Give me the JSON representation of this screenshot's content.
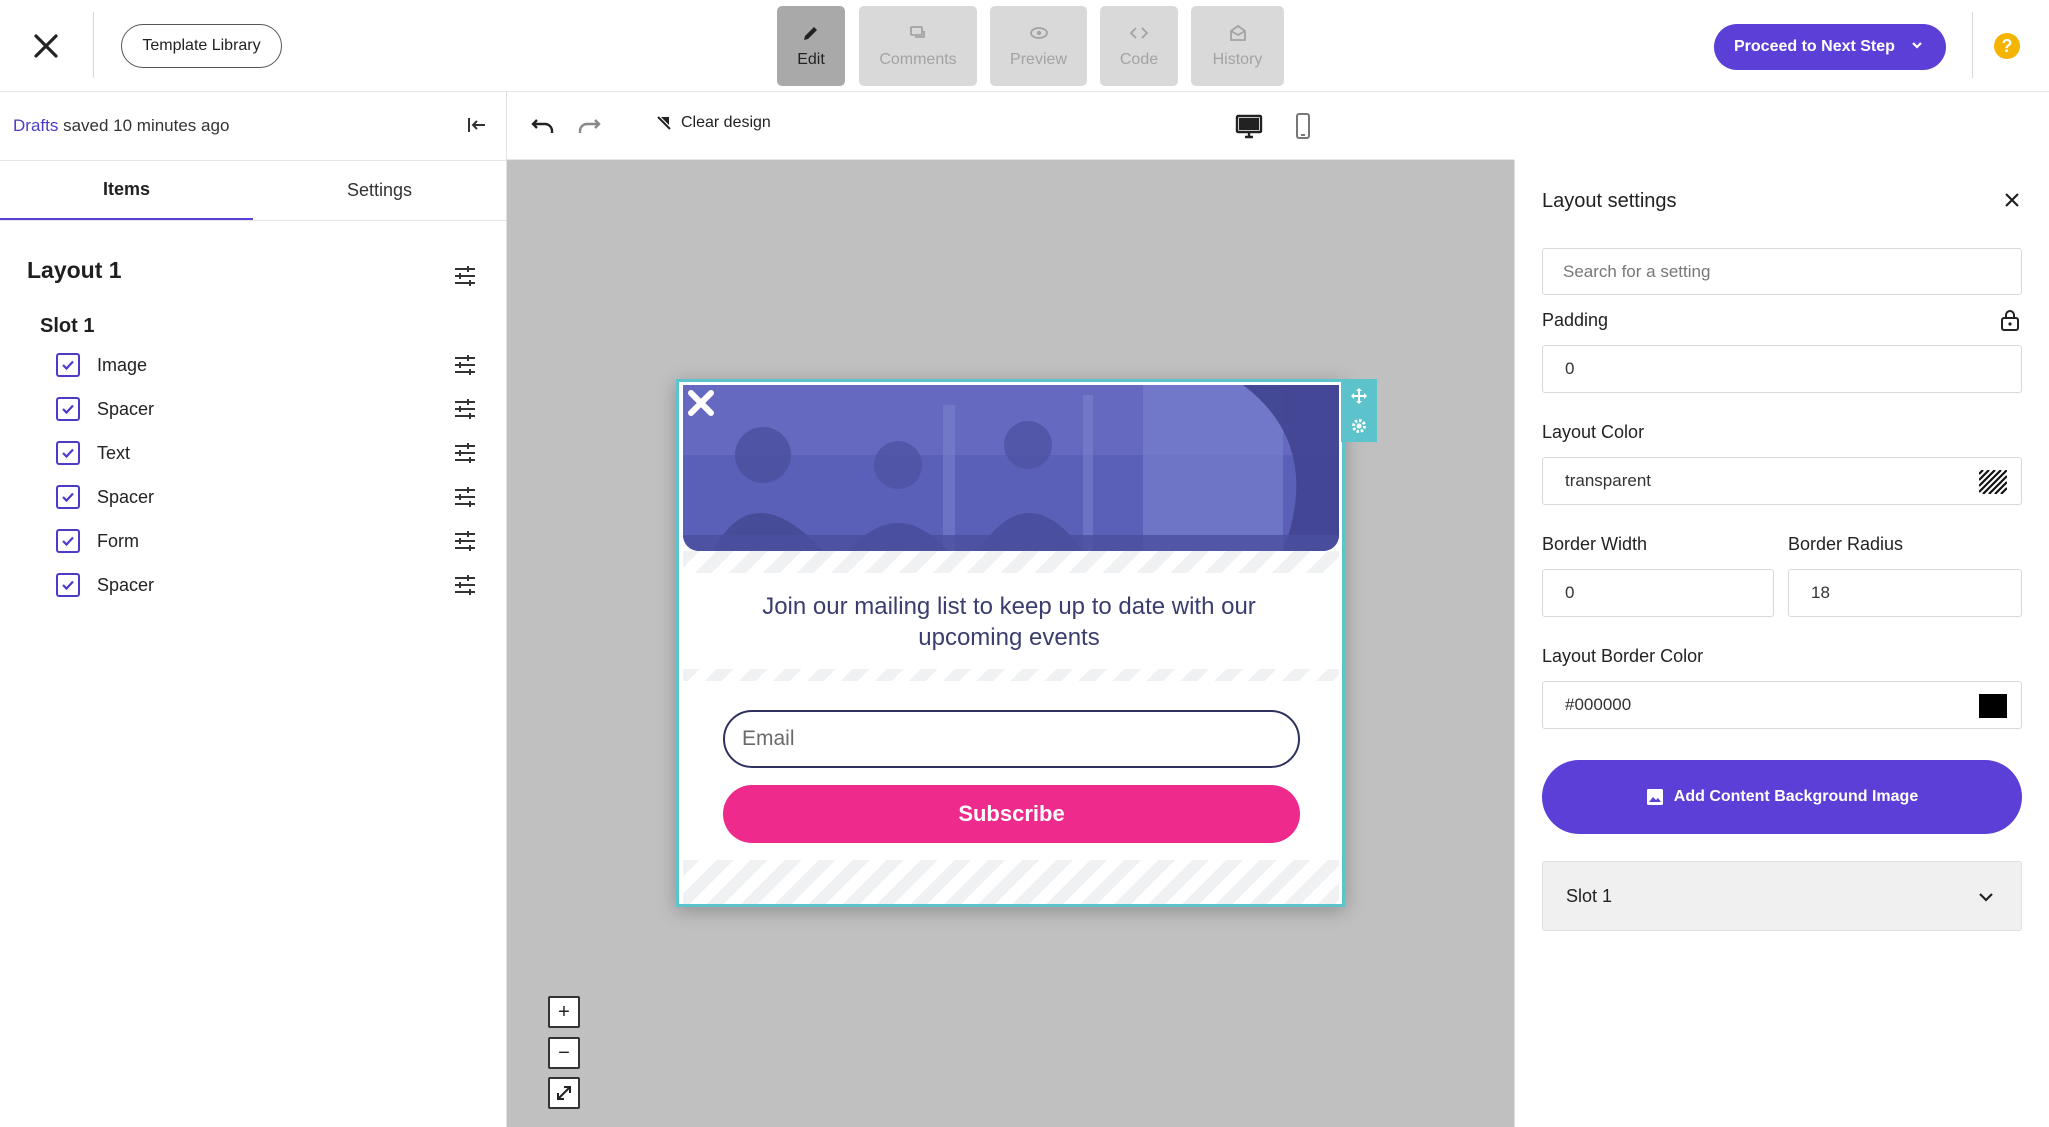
{
  "header": {
    "template_library": "Template Library",
    "modes": [
      {
        "label": "Edit",
        "icon": "pencil-icon"
      },
      {
        "label": "Comments",
        "icon": "comments-icon"
      },
      {
        "label": "Preview",
        "icon": "eye-icon"
      },
      {
        "label": "Code",
        "icon": "code-icon"
      },
      {
        "label": "History",
        "icon": "history-icon"
      }
    ],
    "proceed": "Proceed to Next Step",
    "help": "?"
  },
  "left_panel": {
    "saved_link": "Drafts",
    "saved_text": " saved 10 minutes ago",
    "tabs": [
      "Items",
      "Settings"
    ],
    "layout_title": "Layout 1",
    "slot_title": "Slot 1",
    "items": [
      {
        "label": "Image",
        "checked": true
      },
      {
        "label": "Spacer",
        "checked": true
      },
      {
        "label": "Text",
        "checked": true
      },
      {
        "label": "Spacer",
        "checked": true
      },
      {
        "label": "Form",
        "checked": true
      },
      {
        "label": "Spacer",
        "checked": true
      }
    ]
  },
  "toolbar": {
    "clear_design": "Clear design"
  },
  "popup": {
    "headline": "Join our mailing list to keep up to date with our upcoming events",
    "email_placeholder": "Email",
    "subscribe": "Subscribe",
    "colors": {
      "button": "#ee2a8c",
      "border": "#5cc2cc",
      "hero_tint": "#5a60b8"
    }
  },
  "zoom": {
    "plus": "+",
    "minus": "−"
  },
  "right_panel": {
    "title": "Layout settings",
    "search_placeholder": "Search for a setting",
    "padding_label": "Padding",
    "padding_value": "0",
    "layout_color_label": "Layout Color",
    "layout_color_value": "transparent",
    "border_width_label": "Border Width",
    "border_width_value": "0",
    "border_radius_label": "Border Radius",
    "border_radius_value": "18",
    "border_color_label": "Layout Border Color",
    "border_color_value": "#000000",
    "add_bg": "Add Content Background Image",
    "slot_accordion": "Slot 1"
  },
  "colors": {
    "accent": "#5b3fd6",
    "help": "#f5b400"
  }
}
